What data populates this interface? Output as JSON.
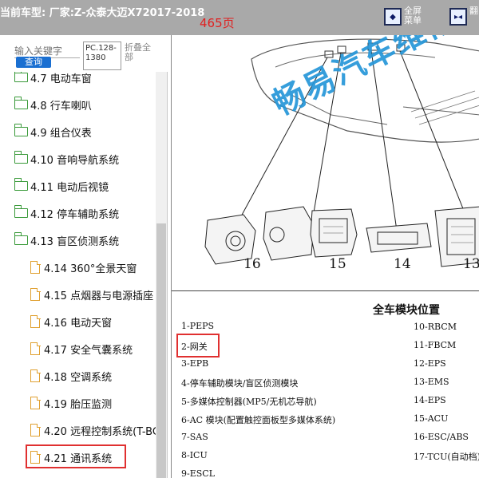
{
  "topbar": {
    "car_label": "当前车型:  厂家:Z-众泰大迈X72017-2018",
    "page_label": "465页",
    "fullscreen_label": "全屏\n菜单",
    "next_label": "翻"
  },
  "search": {
    "placeholder": "输入关键字",
    "button_label": "查询",
    "pc_tab_label": "PC.128-1380",
    "fold_label": "折叠全部"
  },
  "tree": {
    "items": [
      {
        "label": "4.7 电动车窗",
        "type": "folder"
      },
      {
        "label": "4.8 行车喇叭",
        "type": "folder"
      },
      {
        "label": "4.9 组合仪表",
        "type": "folder"
      },
      {
        "label": "4.10 音响导航系统",
        "type": "folder"
      },
      {
        "label": "4.11 电动后视镜",
        "type": "folder"
      },
      {
        "label": "4.12 停车辅助系统",
        "type": "folder"
      },
      {
        "label": "4.13 盲区侦测系统",
        "type": "folder"
      },
      {
        "label": "4.14 360°全景天窗",
        "type": "doc"
      },
      {
        "label": "4.15 点烟器与电源插座",
        "type": "doc"
      },
      {
        "label": "4.16 电动天窗",
        "type": "doc"
      },
      {
        "label": "4.17 安全气囊系统",
        "type": "doc"
      },
      {
        "label": "4.18 空调系统",
        "type": "doc"
      },
      {
        "label": "4.19 胎压监测",
        "type": "doc"
      },
      {
        "label": "4.20 远程控制系统(T-BC",
        "type": "doc"
      },
      {
        "label": "4.21 通讯系统",
        "type": "doc"
      }
    ]
  },
  "document": {
    "watermark": "畅易汽车维修",
    "numbers": [
      "16",
      "15",
      "14",
      "13"
    ],
    "caption": "全车模块位置",
    "left_modules": [
      "1-PEPS",
      "2-网关",
      "3-EPB",
      "4-停车辅助模块/盲区侦测模块",
      "5-多媒体控制器(MP5/无机芯导航)",
      "6-AC 模块(配置触控面板型多媒体系统)",
      "7-SAS",
      "8-ICU",
      "9-ESCL"
    ],
    "right_modules": [
      "10-RBCM",
      "11-FBCM",
      "12-EPS",
      "13-EMS",
      "14-EPS",
      "15-ACU",
      "16-ESC/ABS",
      "17-TCU(自动档)"
    ]
  },
  "colors": {
    "topbar_bg": "#a9a9a9",
    "page_red": "#e02020",
    "query_blue": "#1a6fd1",
    "watermark_blue": "#2596d8",
    "folder_green": "#3a9a3a",
    "doc_orange": "#e0a030",
    "highlight_red": "#e03030"
  }
}
